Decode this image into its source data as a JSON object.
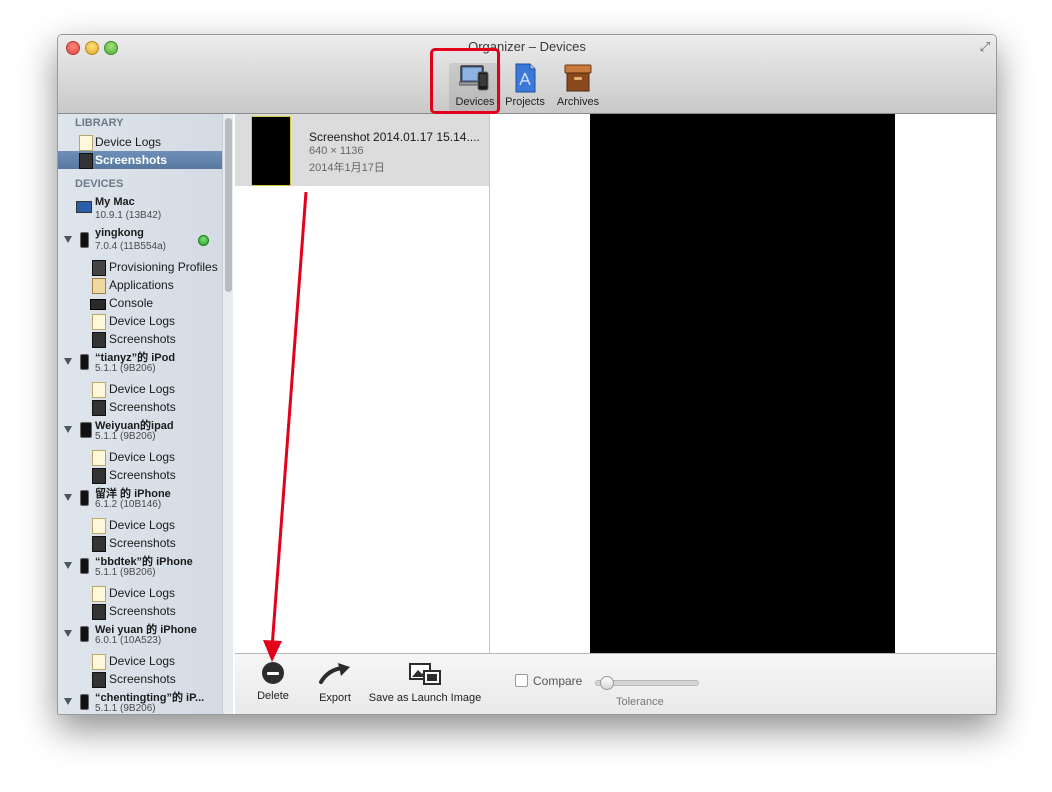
{
  "window": {
    "title": "Organizer – Devices",
    "fullscreen_glyph": "⤢"
  },
  "toolbar": {
    "items": [
      {
        "label": "Devices",
        "icon": "devices-icon",
        "selected": true
      },
      {
        "label": "Projects",
        "icon": "projects-icon"
      },
      {
        "label": "Archives",
        "icon": "archives-icon"
      }
    ]
  },
  "sidebar": {
    "library_header": "LIBRARY",
    "library_items": [
      {
        "label": "Device Logs",
        "icon": "device-logs-icon"
      },
      {
        "label": "Screenshots",
        "icon": "screenshots-icon",
        "selected": true
      }
    ],
    "devices_header": "DEVICES",
    "devices": [
      {
        "name": "My Mac",
        "version": "10.9.1 (13B42)",
        "kind": "mac",
        "children": []
      },
      {
        "name": "yingkong",
        "version": "7.0.4 (11B554a)",
        "kind": "iphone",
        "connected": true,
        "children": [
          "Provisioning Profiles",
          "Applications",
          "Console",
          "Device Logs",
          "Screenshots"
        ]
      },
      {
        "name": "“tianyz”的 iPod",
        "version": "5.1.1 (9B206)",
        "kind": "iphone",
        "children": [
          "Device Logs",
          "Screenshots"
        ]
      },
      {
        "name": "Weiyuan的ipad",
        "version": "5.1.1 (9B206)",
        "kind": "ipad",
        "children": [
          "Device Logs",
          "Screenshots"
        ]
      },
      {
        "name": "留洋 的 iPhone",
        "version": "6.1.2 (10B146)",
        "kind": "iphone",
        "children": [
          "Device Logs",
          "Screenshots"
        ]
      },
      {
        "name": "“bbdtek”的 iPhone",
        "version": "5.1.1 (9B206)",
        "kind": "iphone",
        "children": [
          "Device Logs",
          "Screenshots"
        ]
      },
      {
        "name": "Wei yuan 的 iPhone",
        "version": "6.0.1 (10A523)",
        "kind": "iphone",
        "children": [
          "Device Logs",
          "Screenshots"
        ]
      },
      {
        "name": "“chentingting”的 iP...",
        "version": "5.1.1 (9B206)",
        "kind": "iphone",
        "children": []
      }
    ]
  },
  "screenshot_list": [
    {
      "title": "Screenshot 2014.01.17 15.14....",
      "size": "640 × 1136",
      "date": "2014年1月17日"
    }
  ],
  "bottom_bar": {
    "delete_label": "Delete",
    "export_label": "Export",
    "launch_label": "Save as Launch Image",
    "compare_label": "Compare",
    "tolerance_label": "Tolerance"
  },
  "colors": {
    "annotation_red": "#e2001a",
    "selection_blue": "#56789f"
  }
}
